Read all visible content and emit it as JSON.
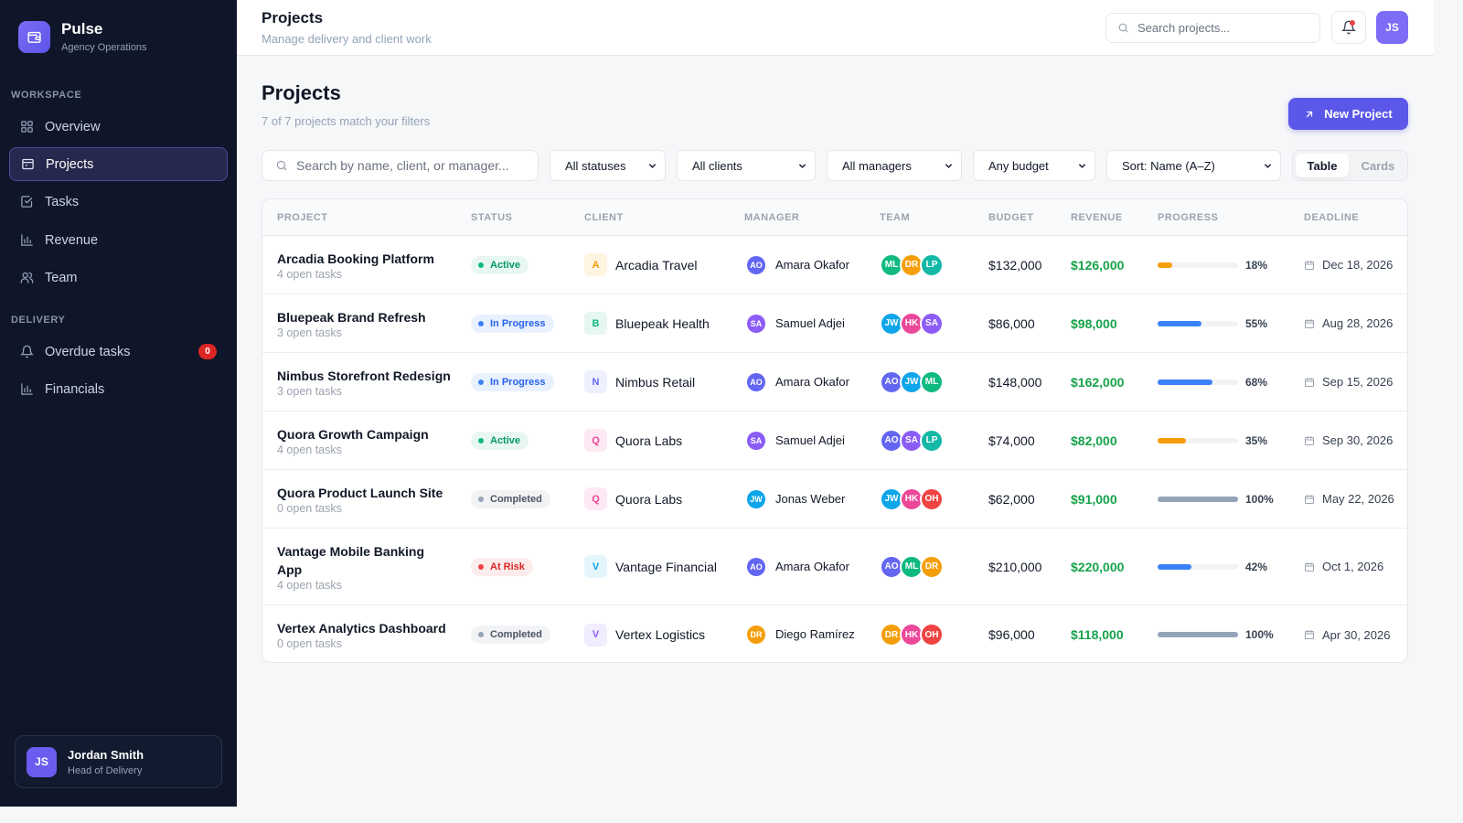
{
  "app": {
    "name": "Pulse",
    "subtitle": "Agency Operations"
  },
  "sidebar": {
    "workspace_label": "WORKSPACE",
    "workspace_items": [
      {
        "label": "Overview",
        "icon": "grid-icon"
      },
      {
        "label": "Projects",
        "icon": "folder-icon",
        "active": true
      },
      {
        "label": "Tasks",
        "icon": "check-square-icon"
      },
      {
        "label": "Revenue",
        "icon": "bar-chart-icon"
      },
      {
        "label": "Team",
        "icon": "users-icon"
      }
    ],
    "delivery_label": "DELIVERY",
    "delivery_items": [
      {
        "label": "Overdue tasks",
        "icon": "bell-icon",
        "badge": "0"
      },
      {
        "label": "Financials",
        "icon": "bar-chart-icon"
      }
    ],
    "user": {
      "initials": "JS",
      "name": "Jordan Smith",
      "role": "Head of Delivery"
    }
  },
  "header": {
    "title": "Projects",
    "subtitle": "Manage delivery and client work",
    "search_placeholder": "Search projects...",
    "avatar_initials": "JS"
  },
  "main": {
    "title": "Projects",
    "subtitle": "7 of 7 projects match your filters",
    "new_button": "New Project",
    "filters": {
      "search_placeholder": "Search by name, client, or manager...",
      "status": "All statuses",
      "client": "All clients",
      "manager": "All managers",
      "budget": "Any budget",
      "sort": "Sort: Name (A–Z)"
    },
    "view_toggle": {
      "table": "Table",
      "cards": "Cards",
      "selected": "Table"
    }
  },
  "colors": {
    "accent": "#5b57e8",
    "sidebar_bg": "#0f1629",
    "revenue": "#16a34a",
    "status_active": "#10b981",
    "status_in_progress": "#3b82f6",
    "status_completed": "#94a3b8",
    "status_at_risk": "#ef4444"
  },
  "table": {
    "columns": [
      "PROJECT",
      "STATUS",
      "CLIENT",
      "MANAGER",
      "TEAM",
      "BUDGET",
      "REVENUE",
      "PROGRESS",
      "DEADLINE"
    ],
    "rows": [
      {
        "name": "Arcadia Booking Platform",
        "tasks": "4 open tasks",
        "status": "Active",
        "status_kind": "active",
        "client": "Arcadia Travel",
        "client_initial": "A",
        "client_color": "#f59e0b",
        "client_bg": "#fff4e0",
        "manager": "Amara Okafor",
        "manager_initials": "AO",
        "manager_color": "#6366f1",
        "team": [
          {
            "i": "ML",
            "c": "#10b981"
          },
          {
            "i": "DR",
            "c": "#f59e0b"
          },
          {
            "i": "LP",
            "c": "#14b8a6"
          }
        ],
        "budget": "$132,000",
        "revenue": "$126,000",
        "progress": 18,
        "progress_label": "18%",
        "progress_color": "#f59e0b",
        "deadline": "Dec 18, 2026"
      },
      {
        "name": "Bluepeak Brand Refresh",
        "tasks": "3 open tasks",
        "status": "In Progress",
        "status_kind": "progress",
        "client": "Bluepeak Health",
        "client_initial": "B",
        "client_color": "#10b981",
        "client_bg": "#e6f7ef",
        "manager": "Samuel Adjei",
        "manager_initials": "SA",
        "manager_color": "#8b5cf6",
        "team": [
          {
            "i": "JW",
            "c": "#0ea5e9"
          },
          {
            "i": "HK",
            "c": "#ec4899"
          },
          {
            "i": "SA",
            "c": "#8b5cf6"
          }
        ],
        "budget": "$86,000",
        "revenue": "$98,000",
        "progress": 55,
        "progress_label": "55%",
        "progress_color": "#3b82f6",
        "deadline": "Aug 28, 2026"
      },
      {
        "name": "Nimbus Storefront Redesign",
        "tasks": "3 open tasks",
        "status": "In Progress",
        "status_kind": "progress",
        "client": "Nimbus Retail",
        "client_initial": "N",
        "client_color": "#6366f1",
        "client_bg": "#eef0fe",
        "manager": "Amara Okafor",
        "manager_initials": "AO",
        "manager_color": "#6366f1",
        "team": [
          {
            "i": "AO",
            "c": "#6366f1"
          },
          {
            "i": "JW",
            "c": "#0ea5e9"
          },
          {
            "i": "ML",
            "c": "#10b981"
          }
        ],
        "budget": "$148,000",
        "revenue": "$162,000",
        "progress": 68,
        "progress_label": "68%",
        "progress_color": "#3b82f6",
        "deadline": "Sep 15, 2026"
      },
      {
        "name": "Quora Growth Campaign",
        "tasks": "4 open tasks",
        "status": "Active",
        "status_kind": "active",
        "client": "Quora Labs",
        "client_initial": "Q",
        "client_color": "#ec4899",
        "client_bg": "#fde9f3",
        "manager": "Samuel Adjei",
        "manager_initials": "SA",
        "manager_color": "#8b5cf6",
        "team": [
          {
            "i": "AO",
            "c": "#6366f1"
          },
          {
            "i": "SA",
            "c": "#8b5cf6"
          },
          {
            "i": "LP",
            "c": "#14b8a6"
          }
        ],
        "budget": "$74,000",
        "revenue": "$82,000",
        "progress": 35,
        "progress_label": "35%",
        "progress_color": "#f59e0b",
        "deadline": "Sep 30, 2026"
      },
      {
        "name": "Quora Product Launch Site",
        "tasks": "0 open tasks",
        "status": "Completed",
        "status_kind": "completed",
        "client": "Quora Labs",
        "client_initial": "Q",
        "client_color": "#ec4899",
        "client_bg": "#fde9f3",
        "manager": "Jonas Weber",
        "manager_initials": "JW",
        "manager_color": "#0ea5e9",
        "team": [
          {
            "i": "JW",
            "c": "#0ea5e9"
          },
          {
            "i": "HK",
            "c": "#ec4899"
          },
          {
            "i": "OH",
            "c": "#ef4444"
          }
        ],
        "budget": "$62,000",
        "revenue": "$91,000",
        "progress": 100,
        "progress_label": "100%",
        "progress_color": "#94a3b8",
        "deadline": "May 22, 2026"
      },
      {
        "name": "Vantage Mobile Banking App",
        "tasks": "4 open tasks",
        "status": "At Risk",
        "status_kind": "risk",
        "client": "Vantage Financial",
        "client_initial": "V",
        "client_color": "#0ea5e9",
        "client_bg": "#e5f5fc",
        "manager": "Amara Okafor",
        "manager_initials": "AO",
        "manager_color": "#6366f1",
        "team": [
          {
            "i": "AO",
            "c": "#6366f1"
          },
          {
            "i": "ML",
            "c": "#10b981"
          },
          {
            "i": "DR",
            "c": "#f59e0b"
          }
        ],
        "budget": "$210,000",
        "revenue": "$220,000",
        "progress": 42,
        "progress_label": "42%",
        "progress_color": "#3b82f6",
        "deadline": "Oct 1, 2026"
      },
      {
        "name": "Vertex Analytics Dashboard",
        "tasks": "0 open tasks",
        "status": "Completed",
        "status_kind": "completed",
        "client": "Vertex Logistics",
        "client_initial": "V",
        "client_color": "#8b5cf6",
        "client_bg": "#f1ecfe",
        "manager": "Diego Ramírez",
        "manager_initials": "DR",
        "manager_color": "#f59e0b",
        "team": [
          {
            "i": "DR",
            "c": "#f59e0b"
          },
          {
            "i": "HK",
            "c": "#ec4899"
          },
          {
            "i": "OH",
            "c": "#ef4444"
          }
        ],
        "budget": "$96,000",
        "revenue": "$118,000",
        "progress": 100,
        "progress_label": "100%",
        "progress_color": "#94a3b8",
        "deadline": "Apr 30, 2026"
      }
    ]
  }
}
